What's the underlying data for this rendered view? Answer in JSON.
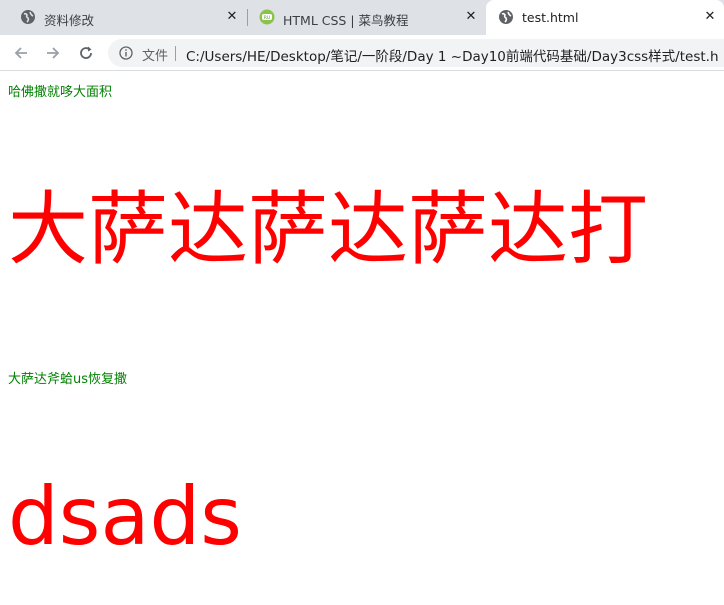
{
  "tabs": [
    {
      "title": "资料修改",
      "icon": "globe-icon",
      "active": false
    },
    {
      "title": "HTML CSS | 菜鸟教程",
      "icon": "runoob-icon",
      "active": false
    },
    {
      "title": "test.html",
      "icon": "globe-icon",
      "active": true
    }
  ],
  "address_bar": {
    "scheme_label": "文件",
    "url": "C:/Users/HE/Desktop/笔记/一阶段/Day 1 ~Day10前端代码基础/Day3css样式/test.h"
  },
  "content": {
    "line1": "哈佛撒就哆大面积",
    "heading1": "大萨达萨达萨达打",
    "line2": "大萨达斧蛤us恢复撒",
    "heading2": "dsads"
  },
  "colors": {
    "small_text": "#008000",
    "big_text": "#ff0000",
    "tabstrip": "#dee1e6"
  }
}
